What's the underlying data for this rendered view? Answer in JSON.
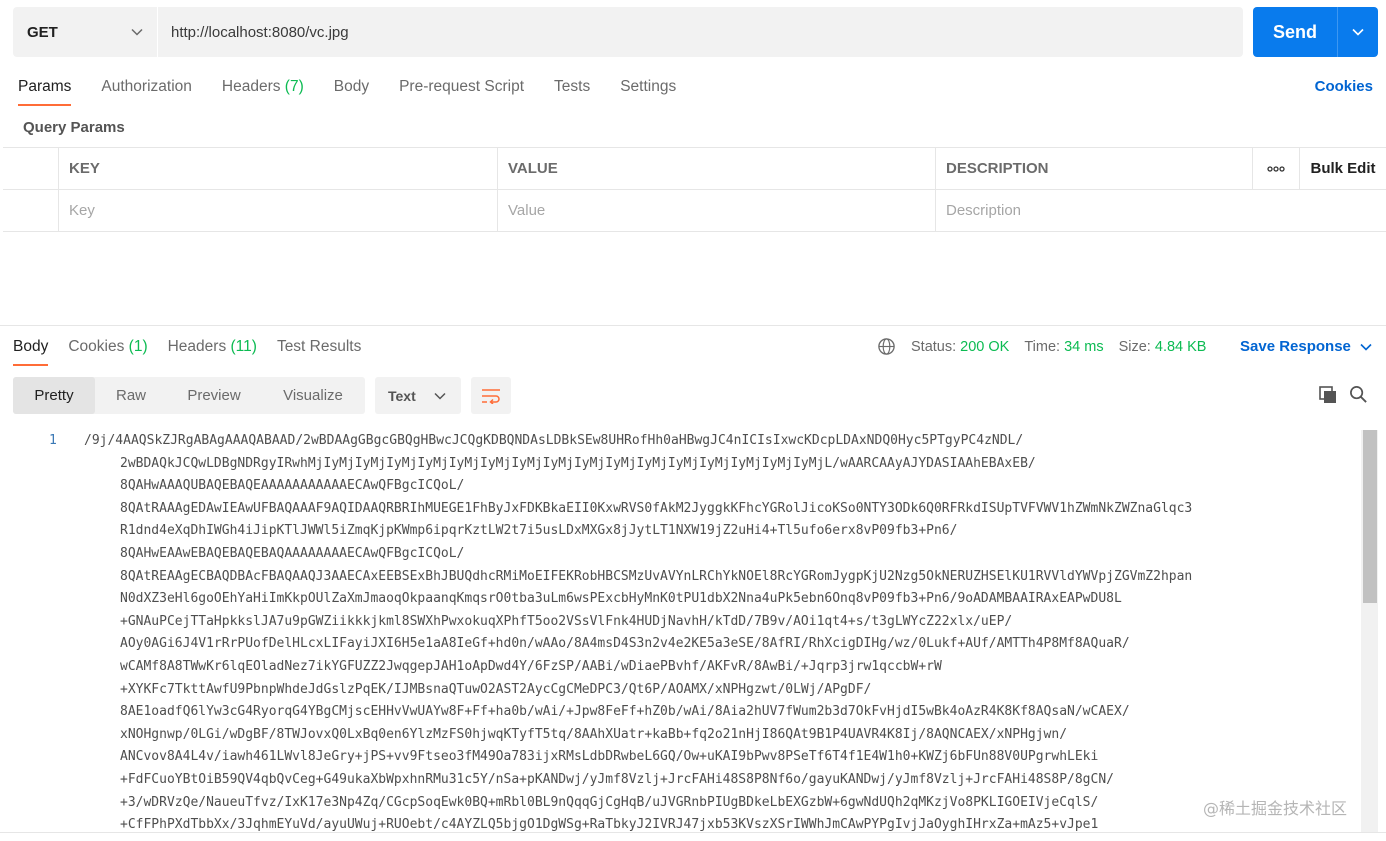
{
  "request": {
    "method": "GET",
    "url": "http://localhost:8080/vc.jpg",
    "send_label": "Send"
  },
  "request_tabs": [
    {
      "label": "Params"
    },
    {
      "label": "Authorization"
    },
    {
      "label": "Headers",
      "count": "(7)"
    },
    {
      "label": "Body"
    },
    {
      "label": "Pre-request Script"
    },
    {
      "label": "Tests"
    },
    {
      "label": "Settings"
    }
  ],
  "cookies_link": "Cookies",
  "query_params": {
    "title": "Query Params",
    "headers": {
      "key": "KEY",
      "value": "VALUE",
      "description": "DESCRIPTION",
      "bulk_edit": "Bulk Edit"
    },
    "placeholders": {
      "key": "Key",
      "value": "Value",
      "description": "Description"
    }
  },
  "response_tabs": [
    {
      "label": "Body"
    },
    {
      "label": "Cookies",
      "count": "(1)"
    },
    {
      "label": "Headers",
      "count": "(11)"
    },
    {
      "label": "Test Results"
    }
  ],
  "status": {
    "status_label": "Status:",
    "status_value": "200 OK",
    "time_label": "Time:",
    "time_value": "34 ms",
    "size_label": "Size:",
    "size_value": "4.84 KB",
    "save_response": "Save Response"
  },
  "view_tabs": [
    "Pretty",
    "Raw",
    "Preview",
    "Visualize"
  ],
  "format": "Text",
  "code": {
    "line_number": "1",
    "lines": [
      "/9j/4AAQSkZJRgABAgAAAQABAAD/2wBDAAgGBgcGBQgHBwcJCQgKDBQNDAsLDBkSEw8UHRofHh0aHBwgJC4nICIsIxwcKDcpLDAxNDQ0Hyc5PTgyPC4zNDL/",
      "2wBDAQkJCQwLDBgNDRgyIRwhMjIyMjIyMjIyMjIyMjIyMjIyMjIyMjIyMjIyMjIyMjIyMjIyMjIyMjIyMjIyMjIyMjL/wAARCAAyAJYDASIAAhEBAxEB/",
      "8QAHwAAAQUBAQEBAQEAAAAAAAAAAAECAwQFBgcICQoL/",
      "8QAtRAAAgEDAwIEAwUFBAQAAAF9AQIDAAQRBRIhMUEGE1FhByJxFDKBkaEII0KxwRVS0fAkM2JyggkKFhcYGRolJicoKSo0NTY3ODk6Q0RFRkdISUpTVFVWV1hZWmNkZWZnaGlqc3",
      "R1dnd4eXqDhIWGh4iJipKTlJWWl5iZmqKjpKWmp6ipqrKztLW2t7i5usLDxMXGx8jJytLT1NXW19jZ2uHi4+Tl5ufo6erx8vP09fb3+Pn6/",
      "8QAHwEAAwEBAQEBAQEBAQAAAAAAAAECAwQFBgcICQoL/",
      "8QAtREAAgECBAQDBAcFBAQAAQJ3AAECAxEEBSExBhJBUQdhcRMiMoEIFEKRobHBCSMzUvAVYnLRChYkNOEl8RcYGRomJygpKjU2Nzg5OkNERUZHSElKU1RVVldYWVpjZGVmZ2hpan",
      "N0dXZ3eHl6goOEhYaHiImKkpOUlZaXmJmaoqOkpaanqKmqsrO0tba3uLm6wsPExcbHyMnK0tPU1dbX2Nna4uPk5ebn6Onq8vP09fb3+Pn6/9oADAMBAAIRAxEAPwDU8L",
      "+GNAuPCejTTaHpkkslJA7u9pGWZiikkkjkml8SWXhPwxokuqXPhfT5oo2VSsVlFnk4HUDjNavhH/kTdD/7B9v/AOi1qt4+s/t3gLWYcZ22xlx/uEP/",
      "AOy0AGi6J4V1rRrPUofDelHLcxLIFayiJXI6H5e1aA8IeGf+hd0n/wAAo/8A4msD4S3n2v4e2KE5a3eSE/8AfRI/RhXcigDIHg/wz/0Lukf+AUf/AMTTh4P8Mf8AQuaR/",
      "wCAMf8A8TWwKr6lqEOladNez7ikYGFUZZ2JwqgepJAH1oApDwd4Y/6FzSP/AABi/wDiaePBvhf/AKFvR/8AwBi/+Jqrp3jrw1qccbW+rW",
      "+XYKFc7TkttAwfU9PbnpWhdeJdGslzPqEK/IJMBsnaQTuwO2AST2AycCgCMeDPC3/Qt6P/AOAMX/xNPHgzwt/0LWj/APgDF/",
      "8AE1oadfQ6lYw3cG4RyorqG4YBgCMjscEHHvVwUAYw8F+Ff+ha0b/wAi/+Jpw8FeFf+hZ0b/wAi/8Aia2hUV7fWum2b3d7OkFvHjdI5wBk4oAzR4K8Kf8AQsaN/wCAEX/",
      "xNOHgnwp/0LGi/wDgBF/8TWJovxQ0LxBq0en6YlzMzFS0hjwqKTyfT5tq/8AAhXUatr+kaBb+fq2o21nHjI86QAt9B1P4UAVR4K8Ij/8AQNCAEX/xNPHgjwn/",
      "ANCvov8A4L4v/iawh461LWvl8JeGry+jPS+vv9Ftseo3fM49Oa783ijxRMsLdbDRwbeL6GQ/Ow+uKAI9bPwv8PSeTf6T4f1E4W1h0+KWZj6bFUn88V0UPgrwhLEki",
      "+FdFCuoYBtOiB59QV4qbQvCeg+G49ukaXbWpxhnRMu31c5Y/nSa+pKANDwj/yJmf8Vzlj+JrcFAHi48S8P8Nf6o/gayuKANDwj/yJmf8Vzlj+JrcFAHi48S8P/8gCN/",
      "+3/wDRVzQe/NaueuTfvz/IxK17e3Np4Zq/CGcpSoqEwk0BQ+mRbl0BL9nQqqGjCgHqB/uJVGRnbPIUgBDkeLbEXGzbW+6gwNdUQh2qMKzjVo8PKLIGOEIVjeCqlS/",
      "+CfFPhPXdTbbXx/3JqhmEYuVd/ayuUWuj+RUOebt/c4AYZLQ5bjgO1DgWSg+RaTbkyJ2IVRJ47jxb53KVszXSrIWWhJmCAwPYPgIvjJaOyghIHrxZa+mAz5+vJpe1"
    ]
  },
  "watermark": "@稀土掘金技术社区",
  "colors": {
    "send": "#097bed",
    "accent_tab": "#ff6c37",
    "link": "#0265d2",
    "green": "#0cbb52"
  }
}
